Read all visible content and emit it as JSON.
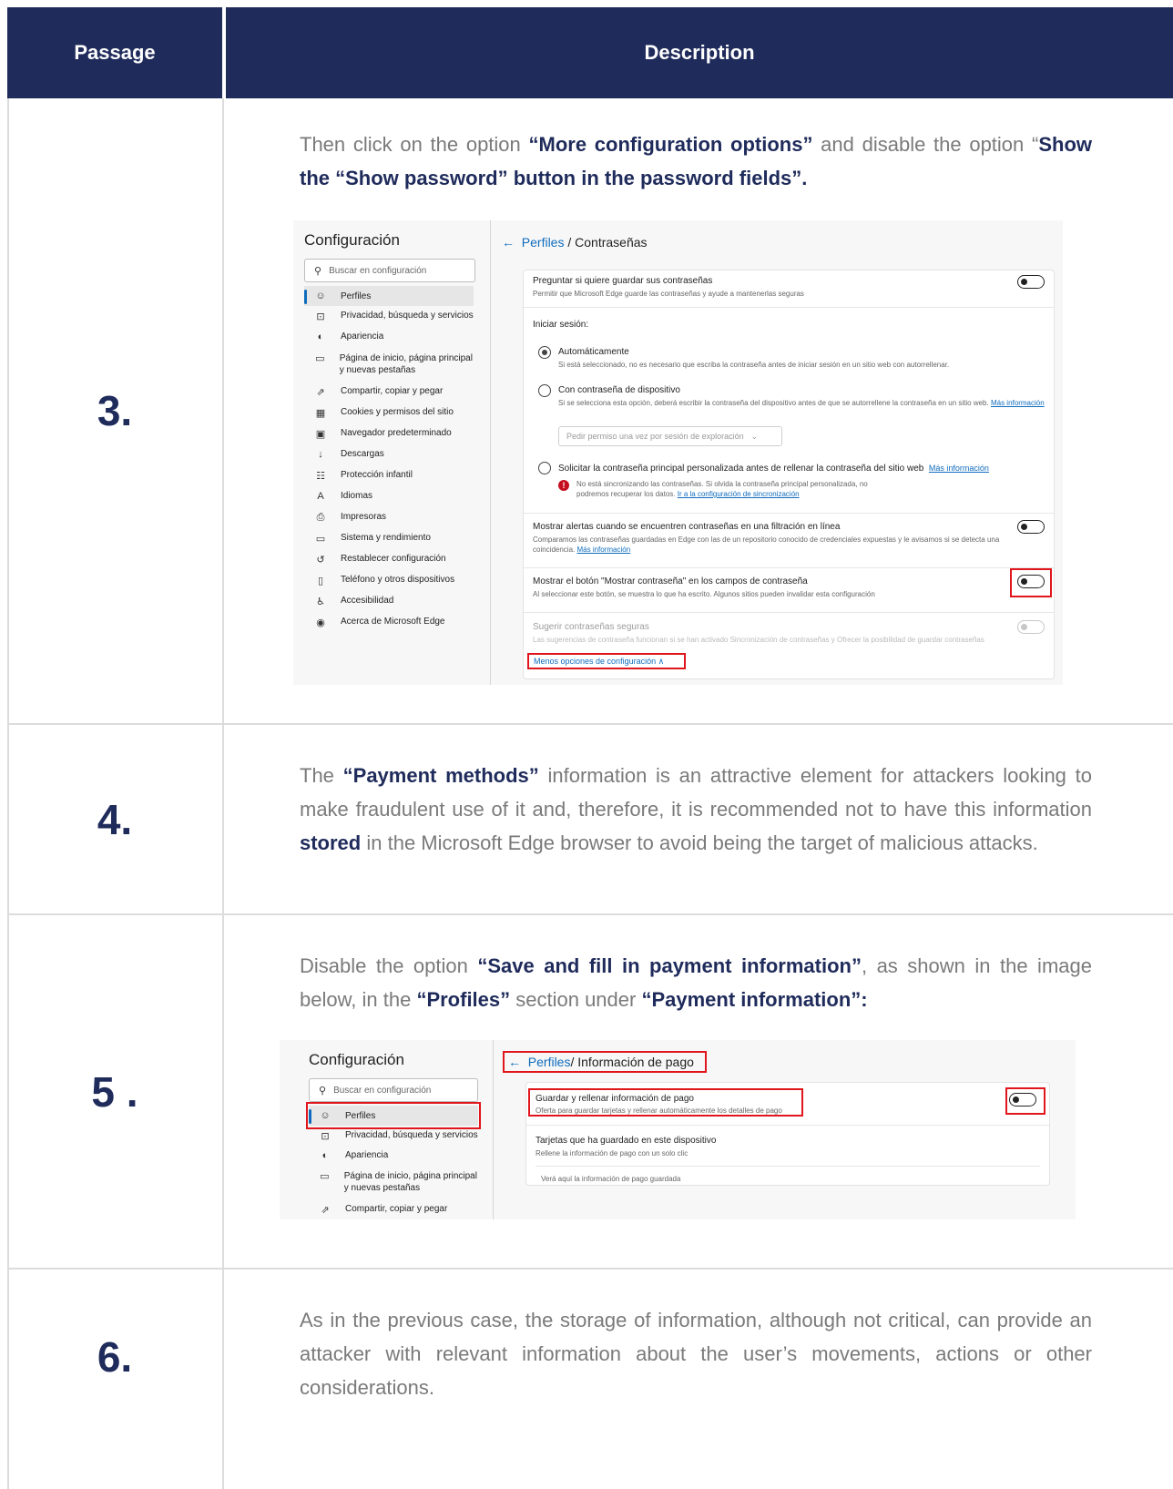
{
  "header": {
    "col1": "Passage",
    "col2": "Description"
  },
  "rows": [
    {
      "num": "3."
    },
    {
      "num": "4."
    },
    {
      "num": "5 ."
    },
    {
      "num": "6."
    }
  ],
  "row3": {
    "p1": "Then click on the option ",
    "b1": "“More configuration options”",
    "p2": " and disable the option “",
    "b2": "Show the “Show password” button in the password fields”."
  },
  "row4": {
    "p1": "The ",
    "b1": "“Payment methods”",
    "p2": " information is an attractive element for attackers looking to make fraudulent use of it and, therefore, it is recommended not to have this information ",
    "b2": "stored",
    "p3": " in the Microsoft Edge browser to avoid being the target of malicious attacks."
  },
  "row5": {
    "p1": "Disable the option ",
    "b1": "“Save and fill in payment information”",
    "p2": ", as shown in the image below, in the ",
    "b2": "“Profiles”",
    "p3": " section under ",
    "b3": "“Payment information”:"
  },
  "row6": {
    "text": "As in the previous case, the storage of information, although not critical, can provide an attacker with relevant information about the user’s movements, actions or other considerations."
  },
  "shot1": {
    "title": "Configuración",
    "search_placeholder": "Buscar en configuración",
    "nav": [
      {
        "icon": "profile-icon",
        "glyph": "☺",
        "label": "Perfiles"
      },
      {
        "icon": "lock-icon",
        "glyph": "🔒",
        "label": "Privacidad, búsqueda y servicios"
      },
      {
        "icon": "appearance-icon",
        "glyph": "◐",
        "label": "Apariencia"
      },
      {
        "icon": "home-icon",
        "glyph": "▭",
        "label": "Página de inicio, página principal y nuevas pestañas"
      },
      {
        "icon": "share-icon",
        "glyph": "⇗",
        "label": "Compartir, copiar y pegar"
      },
      {
        "icon": "cookies-icon",
        "glyph": "▦",
        "label": "Cookies y permisos del sitio"
      },
      {
        "icon": "browser-icon",
        "glyph": "▣",
        "label": "Navegador predeterminado"
      },
      {
        "icon": "download-icon",
        "glyph": "↓",
        "label": "Descargas"
      },
      {
        "icon": "family-icon",
        "glyph": "☷",
        "label": "Protección infantil"
      },
      {
        "icon": "language-icon",
        "glyph": "A",
        "label": "Idiomas"
      },
      {
        "icon": "printer-icon",
        "glyph": "⎙",
        "label": "Impresoras"
      },
      {
        "icon": "system-icon",
        "glyph": "▭",
        "label": "Sistema y rendimiento"
      },
      {
        "icon": "reset-icon",
        "glyph": "↺",
        "label": "Restablecer configuración"
      },
      {
        "icon": "phone-icon",
        "glyph": "▯",
        "label": "Teléfono y otros dispositivos"
      },
      {
        "icon": "accessibility-icon",
        "glyph": "♿",
        "label": "Accesibilidad"
      },
      {
        "icon": "edge-icon",
        "glyph": "◉",
        "label": "Acerca de Microsoft Edge"
      }
    ],
    "breadcrumb_link": "Perfiles",
    "breadcrumb_current": " / Contraseñas",
    "ask_save_title": "Preguntar si quiere guardar sus contraseñas",
    "ask_save_sub": "Permitir que Microsoft Edge guarde las contraseñas y ayude a mantenerlas seguras",
    "signin_label": "Iniciar sesión:",
    "auto_title": "Automáticamente",
    "auto_sub": "Si está seleccionado, no es necesario que escriba la contraseña antes de iniciar sesión en un sitio web con autorrellenar.",
    "device_title": "Con contraseña de dispositivo",
    "device_sub": "Si se selecciona esta opción, deberá escribir la contraseña del dispositivo antes de que se autorrellene la contraseña en un sitio web. ",
    "device_link": "Más información",
    "device_select": "Pedir permiso una vez por sesión de exploración",
    "custom_title": "Solicitar la contraseña principal personalizada antes de rellenar la contraseña del sitio web",
    "custom_link": "Más información",
    "custom_warn": "No está sincronizando las contraseñas. Si olvida la contraseña principal personalizada, no podremos recuperar los datos. ",
    "custom_warn_link": "Ir a la configuración de sincronización",
    "leak_title": "Mostrar alertas cuando se encuentren contraseñas en una filtración en línea",
    "leak_sub": "Comparamos las contraseñas guardadas en Edge con las de un repositorio conocido de credenciales expuestas y le avisamos si se detecta una coincidencia. ",
    "leak_link": "Más información",
    "reveal_title": "Mostrar el botón \"Mostrar contraseña\" en los campos de contraseña",
    "reveal_sub": "Al seleccionar este botón, se muestra lo que ha escrito. Algunos sitios pueden invalidar esta configuración",
    "suggest_title": "Sugerir contraseñas seguras",
    "suggest_sub": "Las sugerencias de contraseña funcionan si se han activado Sincronización de contraseñas y Ofrecer la posibilidad de guardar contraseñas",
    "less_options": "Menos opciones de configuración ∧"
  },
  "shot2": {
    "title": "Configuración",
    "search_placeholder": "Buscar en configuración",
    "nav": [
      {
        "icon": "profile-icon",
        "glyph": "☺",
        "label": "Perfiles"
      },
      {
        "icon": "lock-icon",
        "glyph": "🔒",
        "label": "Privacidad, búsqueda y servicios"
      },
      {
        "icon": "appearance-icon",
        "glyph": "◐",
        "label": "Apariencia"
      },
      {
        "icon": "home-icon",
        "glyph": "▭",
        "label": "Página de inicio, página principal y nuevas pestañas"
      },
      {
        "icon": "share-icon",
        "glyph": "⇗",
        "label": "Compartir, copiar y pegar"
      }
    ],
    "breadcrumb_link": "Perfiles",
    "breadcrumb_current": " / Información de pago",
    "save_title": "Guardar y rellenar información de pago",
    "save_sub": "Oferta para guardar tarjetas y rellenar automáticamente los detalles de pago",
    "cards_title": "Tarjetas que ha guardado en este dispositivo",
    "cards_sub": "Rellene la información de pago con un solo clic",
    "cards_note": "Verá aquí la información de pago guardada"
  }
}
